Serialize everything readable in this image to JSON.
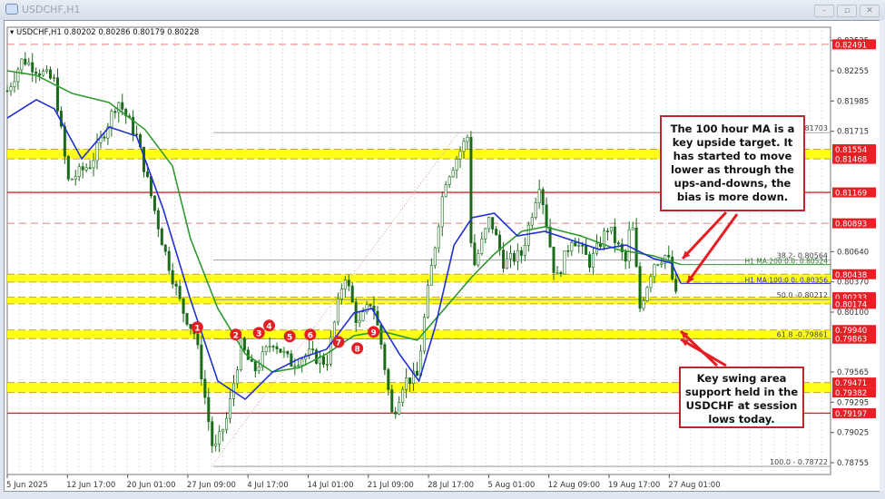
{
  "window": {
    "title": "USDCHF,H1",
    "buttons": [
      "minimize",
      "restore",
      "close"
    ]
  },
  "info_line": {
    "symbol": "USDCHF,H1",
    "open": "0.80202",
    "high": "0.80286",
    "low": "0.80179",
    "close": "0.80228"
  },
  "annotations": {
    "ma_note": "The 100 hour MA is a key upside target. It has started to move lower as through the ups-and-downs, the bias is more down.",
    "support_note": "Key swing area support held in the USDCHF at session lows today."
  },
  "colors": {
    "candle": "#1a6a1a",
    "ma100": "#1f2fd6",
    "ma200": "#2e9a2e",
    "red_line": "#d6262d",
    "yellow": "#ffff00",
    "label_bg": "#e81f25"
  },
  "chart_data": {
    "type": "candlestick",
    "title": "USDCHF,H1",
    "x_tick_labels": [
      "5 Jun 2025",
      "12 Jun 17:00",
      "20 Jun 01:00",
      "27 Jun 09:00",
      "4 Jul 17:00",
      "14 Jul 01:00",
      "21 Jul 09:00",
      "28 Jul 17:00",
      "5 Aug 01:00",
      "12 Aug 09:00",
      "19 Aug 17:00",
      "27 Aug 01:00"
    ],
    "y_tick_labels": [
      "0.82525",
      "0.82255",
      "0.81985",
      "0.81715",
      "0.80640",
      "0.80370",
      "0.80100",
      "0.79565",
      "0.79295",
      "0.79025",
      "0.78755"
    ],
    "ylim": [
      0.787,
      0.8262
    ],
    "price_path_day_price": [
      [
        0,
        0.82077
      ],
      [
        1.8,
        0.8236
      ],
      [
        5.5,
        0.82158
      ],
      [
        7.1,
        0.81267
      ],
      [
        9.8,
        0.81429
      ],
      [
        12.9,
        0.81996
      ],
      [
        15.1,
        0.81672
      ],
      [
        18.2,
        0.80699
      ],
      [
        20.4,
        0.80132
      ],
      [
        22,
        0.79889
      ],
      [
        24.1,
        0.78836
      ],
      [
        25.7,
        0.7916
      ],
      [
        27.3,
        0.79808
      ],
      [
        28.8,
        0.79565
      ],
      [
        31,
        0.79849
      ],
      [
        33.1,
        0.79646
      ],
      [
        35.2,
        0.79727
      ],
      [
        37.3,
        0.79646
      ],
      [
        39.4,
        0.80456
      ],
      [
        41,
        0.7997
      ],
      [
        42.6,
        0.80213
      ],
      [
        43.7,
        0.79808
      ],
      [
        45,
        0.7916
      ],
      [
        46.3,
        0.79484
      ],
      [
        47.9,
        0.79525
      ],
      [
        49,
        0.80213
      ],
      [
        51.1,
        0.81267
      ],
      [
        53.8,
        0.81672
      ],
      [
        54.3,
        0.80456
      ],
      [
        56.4,
        0.80943
      ],
      [
        58,
        0.80538
      ],
      [
        60.1,
        0.80619
      ],
      [
        62.2,
        0.81267
      ],
      [
        64.1,
        0.80375
      ],
      [
        66,
        0.8078
      ],
      [
        68.1,
        0.80538
      ],
      [
        70.2,
        0.80862
      ],
      [
        72.3,
        0.80538
      ],
      [
        72.9,
        0.80983
      ],
      [
        73.9,
        0.80132
      ],
      [
        75.5,
        0.80538
      ],
      [
        77.1,
        0.80619
      ],
      [
        78.5,
        0.80092
      ]
    ],
    "ma100_day_price": [
      [
        0,
        0.81833
      ],
      [
        3.4,
        0.81996
      ],
      [
        5.5,
        0.81915
      ],
      [
        8.7,
        0.81469
      ],
      [
        11.9,
        0.81753
      ],
      [
        15.1,
        0.81672
      ],
      [
        18.2,
        0.81024
      ],
      [
        21.4,
        0.80213
      ],
      [
        24.6,
        0.79484
      ],
      [
        27.8,
        0.79322
      ],
      [
        31,
        0.79565
      ],
      [
        34.2,
        0.79687
      ],
      [
        37.3,
        0.79768
      ],
      [
        40.5,
        0.80092
      ],
      [
        42.6,
        0.80132
      ],
      [
        45.8,
        0.79727
      ],
      [
        48.1,
        0.79484
      ],
      [
        50,
        0.7997
      ],
      [
        52.2,
        0.80699
      ],
      [
        54.3,
        0.80943
      ],
      [
        56.9,
        0.80983
      ],
      [
        59.6,
        0.8078
      ],
      [
        62.8,
        0.80821
      ],
      [
        66,
        0.8074
      ],
      [
        69.2,
        0.80659
      ],
      [
        72.3,
        0.80699
      ],
      [
        75.5,
        0.80578
      ],
      [
        77.6,
        0.80538
      ],
      [
        78.7,
        0.80356
      ]
    ],
    "ma200_day_price": [
      [
        0,
        0.82255
      ],
      [
        3.4,
        0.82214
      ],
      [
        7.6,
        0.82052
      ],
      [
        11.9,
        0.81972
      ],
      [
        16.1,
        0.81729
      ],
      [
        19.3,
        0.81405
      ],
      [
        21.4,
        0.80756
      ],
      [
        24.6,
        0.80132
      ],
      [
        27.8,
        0.79727
      ],
      [
        31,
        0.79565
      ],
      [
        34.2,
        0.79606
      ],
      [
        37.3,
        0.79727
      ],
      [
        40.5,
        0.79889
      ],
      [
        43.7,
        0.7993
      ],
      [
        47.9,
        0.79849
      ],
      [
        51.1,
        0.80132
      ],
      [
        54.3,
        0.80416
      ],
      [
        56.9,
        0.80619
      ],
      [
        60.1,
        0.80821
      ],
      [
        62.8,
        0.80862
      ],
      [
        67,
        0.8078
      ],
      [
        71.3,
        0.80659
      ],
      [
        75.5,
        0.80602
      ],
      [
        78.7,
        0.80524
      ]
    ],
    "levels": [
      {
        "price": 0.82491,
        "label": "0.82491",
        "style": "dashed-red"
      },
      {
        "price": 0.81554,
        "label": "0.81554",
        "style": "yellow-top"
      },
      {
        "price": 0.81468,
        "label": "0.81468",
        "style": "yellow-bottom"
      },
      {
        "price": 0.81169,
        "label": "0.81169",
        "style": "solid-red"
      },
      {
        "price": 0.80893,
        "label": "0.80893",
        "style": "dashed-red"
      },
      {
        "price": 0.80438,
        "label": "0.80438",
        "style": "yellow-top"
      },
      {
        "price": 0.80233,
        "label": "0.80233",
        "style": "yellow-top"
      },
      {
        "price": 0.80174,
        "label": "0.80174",
        "style": "yellow-bottom"
      },
      {
        "price": 0.7994,
        "label": "0.79940",
        "style": "yellow-top"
      },
      {
        "price": 0.79863,
        "label": "0.79863",
        "style": "yellow-bottom"
      },
      {
        "price": 0.79471,
        "label": "0.79471",
        "style": "yellow-top"
      },
      {
        "price": 0.79382,
        "label": "0.79382",
        "style": "yellow-bottom"
      },
      {
        "price": 0.79197,
        "label": "0.79197",
        "style": "solid-red"
      }
    ],
    "fib_levels": [
      {
        "price": 0.81703,
        "label": "0.0-0.81703"
      },
      {
        "price": 0.80564,
        "label": "38.2- 0.80564"
      },
      {
        "price": 0.80212,
        "label": "50.0 -0.80212"
      },
      {
        "price": 0.79861,
        "label": "61.8 -0.79861"
      },
      {
        "price": 0.78722,
        "label": "100.0 - 0.78722"
      }
    ],
    "ma_labels": {
      "ma200": "H1 MA:200:0.0: 0.80524",
      "ma100": "H1 MA:100:0.0: 0.80356"
    },
    "swing_markers": [
      {
        "n": "1",
        "day": 22.2,
        "price": 0.79964
      },
      {
        "n": "2",
        "day": 26.7,
        "price": 0.79899
      },
      {
        "n": "3",
        "day": 29.4,
        "price": 0.79915
      },
      {
        "n": "4",
        "day": 30.6,
        "price": 0.7998
      },
      {
        "n": "5",
        "day": 33,
        "price": 0.79883
      },
      {
        "n": "6",
        "day": 35.4,
        "price": 0.79899
      },
      {
        "n": "7",
        "day": 38.7,
        "price": 0.79834
      },
      {
        "n": "8",
        "day": 40.9,
        "price": 0.79777
      },
      {
        "n": "9",
        "day": 42.8,
        "price": 0.79923
      }
    ]
  }
}
